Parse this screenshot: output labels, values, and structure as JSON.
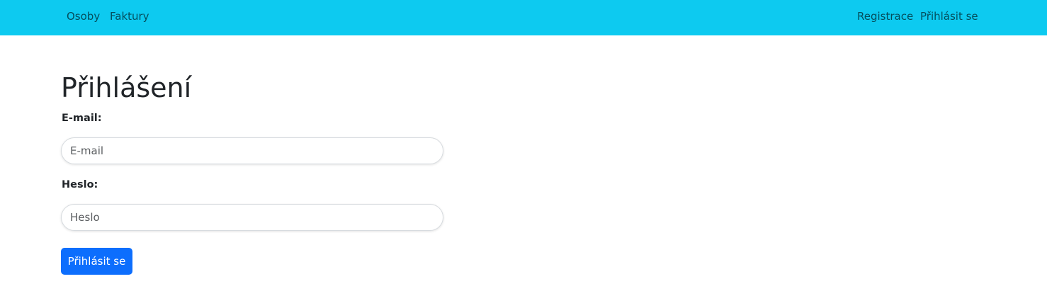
{
  "navbar": {
    "left_links": [
      {
        "label": "Osoby"
      },
      {
        "label": "Faktury"
      }
    ],
    "right_links": [
      {
        "label": "Registrace"
      },
      {
        "label": "Přihlásit se"
      }
    ],
    "background_color": "#0dcaf0"
  },
  "main": {
    "title": "Přihlášení",
    "form": {
      "email_label": "E-mail:",
      "email_placeholder": "E-mail",
      "email_value": "",
      "password_label": "Heslo:",
      "password_placeholder": "Heslo",
      "password_value": "",
      "submit_label": "Přihlásit se",
      "submit_color": "#0d6efd"
    }
  }
}
